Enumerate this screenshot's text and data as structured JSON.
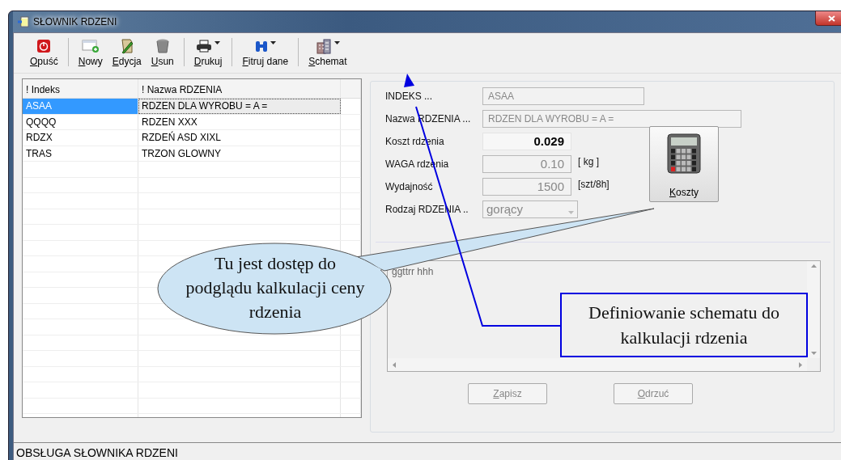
{
  "window": {
    "title": "SŁOWNIK RDZENI"
  },
  "toolbar": [
    [
      {
        "label": "Opuść",
        "kind": "power",
        "dropdown": false
      }
    ],
    [
      {
        "label": "Nowy",
        "kind": "new",
        "dropdown": false
      },
      {
        "label": "Edycja",
        "kind": "edit",
        "dropdown": false
      },
      {
        "label": "Usun",
        "kind": "trash",
        "dropdown": false
      }
    ],
    [
      {
        "label": "Drukuj",
        "kind": "print",
        "dropdown": true
      }
    ],
    [
      {
        "label": "Fitruj dane",
        "kind": "binoculars",
        "dropdown": true
      }
    ],
    [
      {
        "label": "Schemat",
        "kind": "building",
        "dropdown": true
      }
    ]
  ],
  "table": {
    "columns": [
      "! Indeks",
      "! Nazwa RDZENIA"
    ],
    "rows": [
      {
        "cells": [
          "ASAA",
          "RDZEN DLA WYROBU = A ="
        ],
        "selected": true
      },
      {
        "cells": [
          "QQQQ",
          "RDZEN XXX"
        ],
        "selected": false
      },
      {
        "cells": [
          "RDZX",
          "RZDEŃ ASD XIXL"
        ],
        "selected": false
      },
      {
        "cells": [
          "TRAS",
          "TRZON GLOWNY"
        ],
        "selected": false
      }
    ]
  },
  "form": {
    "fields": [
      {
        "kind": "text",
        "label": "INDEKS ...",
        "value": "ASAA"
      },
      {
        "kind": "text",
        "label": "Nazwa RDZENIA ...",
        "value": "RDZEN DLA WYROBU = A ="
      },
      {
        "kind": "readout",
        "label": "Koszt rdzenia",
        "value": "0.029"
      },
      {
        "kind": "number",
        "label": "WAGA rdzenia",
        "value": "0.10",
        "unit": "[ kg ]"
      },
      {
        "kind": "number",
        "label": "Wydajność",
        "value": "1500",
        "unit": "[szt/8h]"
      },
      {
        "kind": "select",
        "label": "Rodzaj RDZENIA ..",
        "value": "gorący"
      }
    ],
    "costs_button": "Koszty",
    "memo": "ggttrr hhh",
    "buttons": [
      {
        "label": "Zapisz",
        "disabled": true
      },
      {
        "label": "Odrzuć",
        "disabled": true
      }
    ]
  },
  "status_bar": "OBSŁUGA SŁOWNIKA RDZENI",
  "annotations": [
    {
      "kind": "oval",
      "text": "Tu jest dostęp do podglądu kalkulacji ceny rdzenia"
    },
    {
      "kind": "box",
      "text": "Definiowanie schematu do kalkulacji rdzenia"
    }
  ]
}
